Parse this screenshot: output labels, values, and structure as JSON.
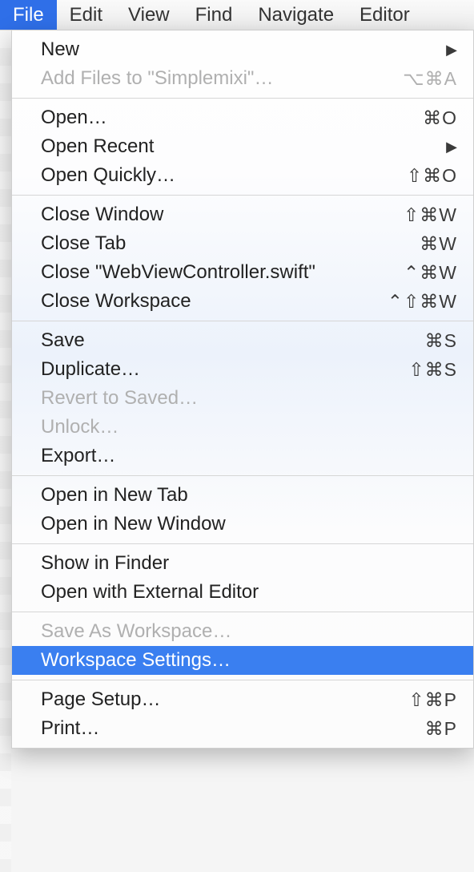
{
  "menubar": {
    "items": [
      {
        "label": "File",
        "active": true
      },
      {
        "label": "Edit"
      },
      {
        "label": "View"
      },
      {
        "label": "Find"
      },
      {
        "label": "Navigate"
      },
      {
        "label": "Editor"
      }
    ]
  },
  "file_menu": {
    "groups": [
      [
        {
          "label": "New",
          "shortcut": "",
          "submenu": true
        },
        {
          "label": "Add Files to \"Simplemixi\"…",
          "shortcut": "⌥⌘A",
          "disabled": true
        }
      ],
      [
        {
          "label": "Open…",
          "shortcut": "⌘O"
        },
        {
          "label": "Open Recent",
          "shortcut": "",
          "submenu": true
        },
        {
          "label": "Open Quickly…",
          "shortcut": "⇧⌘O"
        }
      ],
      [
        {
          "label": "Close Window",
          "shortcut": "⇧⌘W"
        },
        {
          "label": "Close Tab",
          "shortcut": "⌘W"
        },
        {
          "label": "Close \"WebViewController.swift\"",
          "shortcut": "⌃⌘W"
        },
        {
          "label": "Close Workspace",
          "shortcut": "⌃⇧⌘W"
        }
      ],
      [
        {
          "label": "Save",
          "shortcut": "⌘S"
        },
        {
          "label": "Duplicate…",
          "shortcut": "⇧⌘S"
        },
        {
          "label": "Revert to Saved…",
          "shortcut": "",
          "disabled": true
        },
        {
          "label": "Unlock…",
          "shortcut": "",
          "disabled": true
        },
        {
          "label": "Export…",
          "shortcut": ""
        }
      ],
      [
        {
          "label": "Open in New Tab",
          "shortcut": ""
        },
        {
          "label": "Open in New Window",
          "shortcut": ""
        }
      ],
      [
        {
          "label": "Show in Finder",
          "shortcut": ""
        },
        {
          "label": "Open with External Editor",
          "shortcut": ""
        }
      ],
      [
        {
          "label": "Save As Workspace…",
          "shortcut": "",
          "disabled": true
        },
        {
          "label": "Workspace Settings…",
          "shortcut": "",
          "highlighted": true
        }
      ],
      [
        {
          "label": "Page Setup…",
          "shortcut": "⇧⌘P"
        },
        {
          "label": "Print…",
          "shortcut": "⌘P"
        }
      ]
    ]
  }
}
